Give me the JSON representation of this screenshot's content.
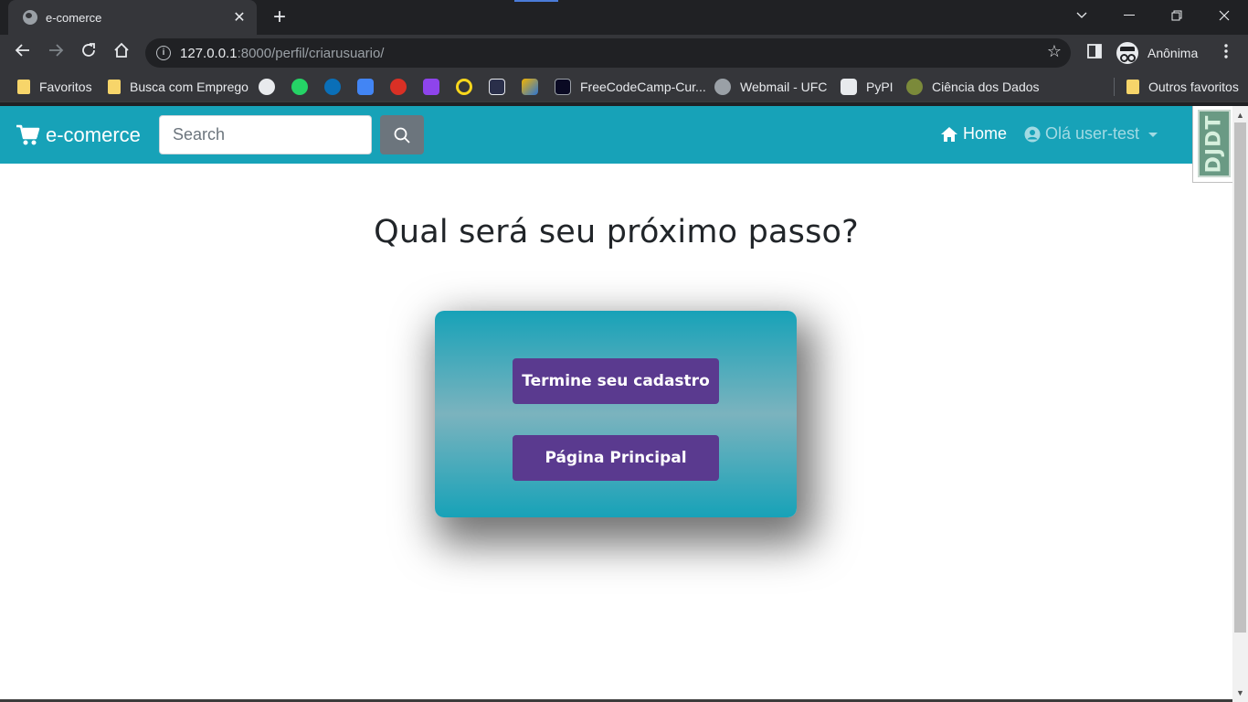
{
  "browser": {
    "tab_title": "e-comerce",
    "url_host": "127.0.0.1",
    "url_path": ":8000/perfil/criarusuario/",
    "profile_name": "Anônima",
    "bookmarks": [
      {
        "label": "Favoritos",
        "icon": "folder-icon"
      },
      {
        "label": "Busca com Emprego",
        "icon": "folder-icon"
      },
      {
        "label": "",
        "icon": "github-icon"
      },
      {
        "label": "",
        "icon": "whatsapp-icon"
      },
      {
        "label": "",
        "icon": "dell-icon"
      },
      {
        "label": "",
        "icon": "calendar-icon"
      },
      {
        "label": "",
        "icon": "gmail-icon"
      },
      {
        "label": "",
        "icon": "udemy-icon"
      },
      {
        "label": "",
        "icon": "ring-icon"
      },
      {
        "label": "",
        "icon": "m-icon"
      },
      {
        "label": "",
        "icon": "puzzle-icon"
      },
      {
        "label": "FreeCodeCamp-Cur...",
        "icon": "freecodecamp-icon"
      },
      {
        "label": "Webmail - UFC",
        "icon": "globe-icon"
      },
      {
        "label": "PyPI",
        "icon": "pypi-icon"
      },
      {
        "label": "Ciência dos Dados",
        "icon": "brain-icon"
      }
    ],
    "other_bookmarks": "Outros favoritos"
  },
  "navbar": {
    "brand": "e-comerce",
    "search_placeholder": "Search",
    "home_label": "Home",
    "user_label": "Olá user-test",
    "debug_toolbar_label": "DJDT"
  },
  "main": {
    "heading": "Qual será seu próximo passo?",
    "primary_button": "Termine seu cadastro",
    "secondary_button": "Página Principal"
  },
  "colors": {
    "navbar": "#17a2b8",
    "button": "#5a3a8f",
    "search_button": "#6c757d"
  }
}
